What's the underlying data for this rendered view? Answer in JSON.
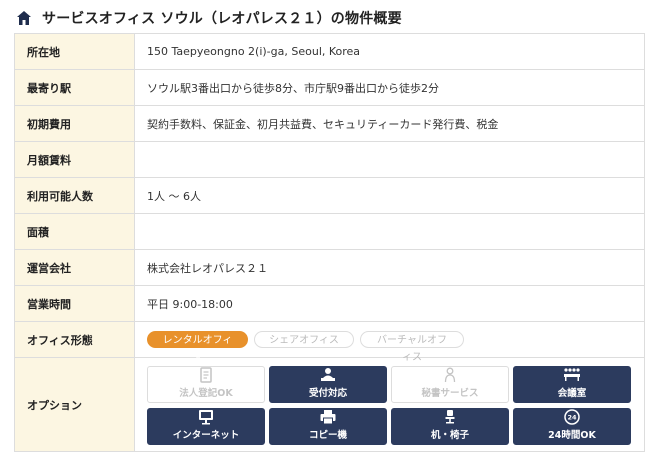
{
  "header": {
    "title": "サービスオフィス ソウル（レオパレス２１）の物件概要"
  },
  "rows": {
    "address": {
      "label": "所在地",
      "value": "150 Taepyeongno 2(i)-ga, Seoul, Korea"
    },
    "station": {
      "label": "最寄り駅",
      "value": "ソウル駅3番出口から徒歩8分、市庁駅9番出口から徒歩2分"
    },
    "initial_cost": {
      "label": "初期費用",
      "value": "契約手数料、保証金、初月共益費、セキュリティーカード発行費、税金"
    },
    "monthly_rent": {
      "label": "月額賃料",
      "value": ""
    },
    "capacity": {
      "label": "利用可能人数",
      "value": "1人 〜 6人"
    },
    "area": {
      "label": "面積",
      "value": ""
    },
    "operator": {
      "label": "運営会社",
      "value": "株式会社レオパレス２１"
    },
    "hours": {
      "label": "営業時間",
      "value": "平日 9:00-18:00"
    },
    "office_type": {
      "label": "オフィス形態",
      "types": [
        "レンタルオフィス",
        "シェアオフィス",
        "バーチャルオフィス"
      ],
      "selected": "レンタルオフィス"
    },
    "options": {
      "label": "オプション",
      "items": [
        {
          "label": "法人登記OK",
          "available": false,
          "icon": "document-icon"
        },
        {
          "label": "受付対応",
          "available": true,
          "icon": "reception-icon"
        },
        {
          "label": "秘書サービス",
          "available": false,
          "icon": "secretary-icon"
        },
        {
          "label": "会議室",
          "available": true,
          "icon": "meeting-room-icon"
        },
        {
          "label": "インターネット",
          "available": true,
          "icon": "monitor-icon"
        },
        {
          "label": "コピー機",
          "available": true,
          "icon": "printer-icon"
        },
        {
          "label": "机・椅子",
          "available": true,
          "icon": "chair-icon"
        },
        {
          "label": "24時間OK",
          "available": true,
          "icon": "clock-24-icon"
        }
      ]
    }
  },
  "colors": {
    "accent": "#e8912b",
    "active_option": "#2c3b5e",
    "label_bg": "#fcf6e2",
    "title_icon": "#1f2d4d"
  }
}
